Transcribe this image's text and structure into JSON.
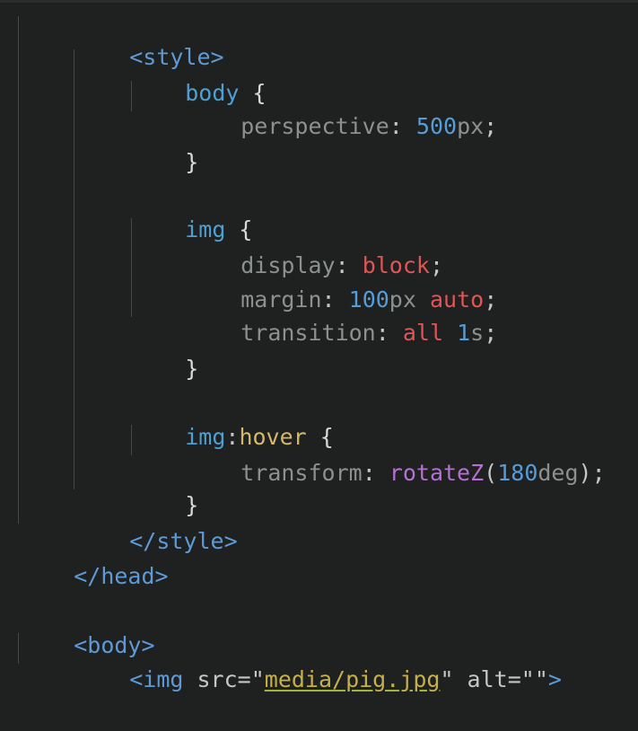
{
  "code": {
    "l1": "<style>",
    "l2_sel": "body",
    "l2_brace": " {",
    "l3_prop": "perspective",
    "l3_colon": ": ",
    "l3_num": "500",
    "l3_unit": "px",
    "l3_end": ";",
    "l4": "}",
    "l6_sel": "img",
    "l6_brace": " {",
    "l7_prop": "display",
    "l7_colon": ": ",
    "l7_val": "block",
    "l7_end": ";",
    "l8_prop": "margin",
    "l8_colon": ": ",
    "l8_num": "100",
    "l8_unit": "px",
    "l8_sp": " ",
    "l8_val": "auto",
    "l8_end": ";",
    "l9_prop": "transition",
    "l9_colon": ": ",
    "l9_val": "all",
    "l9_sp": " ",
    "l9_num": "1",
    "l9_unit": "s",
    "l9_end": ";",
    "l10": "}",
    "l12_sel": "img",
    "l12_colon": ":",
    "l12_pseudo": "hover",
    "l12_brace": " {",
    "l13_prop": "transform",
    "l13_colon": ": ",
    "l13_fn": "rotateZ",
    "l13_open": "(",
    "l13_num": "180",
    "l13_unit": "deg",
    "l13_close": ");",
    "l14": "}",
    "l15": "</style>",
    "l16": "</head>",
    "l18": "<body>",
    "l19_tag": "<img",
    "l19_attr1": " src=",
    "l19_q1": "\"",
    "l19_str": "media/pig.jpg",
    "l19_q2": "\"",
    "l19_attr2": " alt=",
    "l19_q3": "\"\"",
    "l19_close": ">"
  }
}
